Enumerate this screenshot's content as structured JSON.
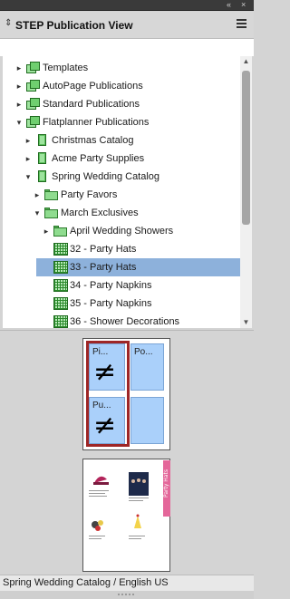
{
  "window": {
    "title": "STEP Publication View",
    "top_controls": [
      "«",
      "×"
    ]
  },
  "tree": {
    "items": [
      {
        "label": "Templates",
        "icon": "publication-icon",
        "expander": "▸"
      },
      {
        "label": "AutoPage Publications",
        "icon": "publication-icon",
        "expander": "▸"
      },
      {
        "label": "Standard Publications",
        "icon": "publication-icon",
        "expander": "▸"
      },
      {
        "label": "Flatplanner Publications",
        "icon": "publication-icon",
        "expander": "▾"
      },
      {
        "label": "Christmas Catalog",
        "icon": "catalog-icon",
        "expander": "▸"
      },
      {
        "label": "Acme Party Supplies",
        "icon": "catalog-icon",
        "expander": "▸"
      },
      {
        "label": "Spring Wedding Catalog",
        "icon": "catalog-icon",
        "expander": "▾"
      },
      {
        "label": "Party Favors",
        "icon": "folder-icon",
        "expander": "▸"
      },
      {
        "label": "March Exclusives",
        "icon": "folder-icon",
        "expander": "▾"
      },
      {
        "label": "April Wedding Showers",
        "icon": "folder-icon",
        "expander": "▸"
      },
      {
        "label": "32 - Party Hats",
        "icon": "page-icon",
        "expander": ""
      },
      {
        "label": "33 - Party Hats",
        "icon": "page-icon",
        "expander": "",
        "selected": true
      },
      {
        "label": "34 - Party Napkins",
        "icon": "page-icon",
        "expander": ""
      },
      {
        "label": "35 - Party Napkins",
        "icon": "page-icon",
        "expander": ""
      },
      {
        "label": "36 - Shower Decorations",
        "icon": "page-icon",
        "expander": ""
      }
    ]
  },
  "scrollbar": {
    "up": "▲",
    "down": "▼"
  },
  "preview": {
    "slots": [
      "Pi...",
      "Po...",
      "Pu...",
      ""
    ],
    "not_equal_glyph": "≠",
    "page2_banner": "Party Hats"
  },
  "status": {
    "text": "Spring Wedding Catalog / English US"
  },
  "colors": {
    "selection": "#8db1db",
    "slot_fill": "#aad0fa",
    "frame_red": "#9e2626",
    "banner_pink": "#e4679a"
  }
}
